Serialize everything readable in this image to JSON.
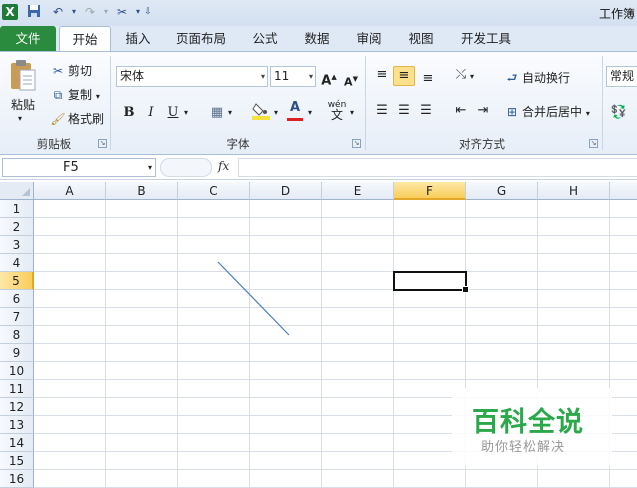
{
  "window": {
    "title": "工作簿"
  },
  "qat": {
    "icons": [
      "excel-logo-icon",
      "save-icon",
      "undo-icon",
      "redo-icon",
      "customize-icon"
    ]
  },
  "tabs": [
    {
      "label": "文件"
    },
    {
      "label": "开始"
    },
    {
      "label": "插入"
    },
    {
      "label": "页面布局"
    },
    {
      "label": "公式"
    },
    {
      "label": "数据"
    },
    {
      "label": "审阅"
    },
    {
      "label": "视图"
    },
    {
      "label": "开发工具"
    }
  ],
  "clipboard": {
    "paste": "粘贴",
    "cut": "剪切",
    "copy": "复制",
    "format_painter": "格式刷",
    "label": "剪贴板"
  },
  "font": {
    "name": "宋体",
    "size": "11",
    "label": "字体",
    "bold": "B",
    "italic": "I",
    "underline": "U",
    "grow": "A",
    "shrink": "A",
    "color_a": "A",
    "phonetic": "wén"
  },
  "alignment": {
    "wrap": "自动换行",
    "merge": "合并后居中",
    "label": "对齐方式"
  },
  "number": {
    "format": "常规"
  },
  "formula_bar": {
    "name_box": "F5",
    "fx": "fx",
    "value": ""
  },
  "columns": [
    "A",
    "B",
    "C",
    "D",
    "E",
    "F",
    "G",
    "H"
  ],
  "rows": [
    "1",
    "2",
    "3",
    "4",
    "5",
    "6",
    "7",
    "8",
    "9",
    "10",
    "11",
    "12",
    "13",
    "14",
    "15",
    "16"
  ],
  "active_cell": {
    "col": "F",
    "row": "5"
  },
  "watermark": {
    "title": "百科全说",
    "subtitle": "助你轻松解决"
  },
  "colors": {
    "file_tab": "#2a8a3e",
    "highlight": "#f9cd5a",
    "font_color": "#e02020",
    "fill_color": "#f5e23a"
  }
}
